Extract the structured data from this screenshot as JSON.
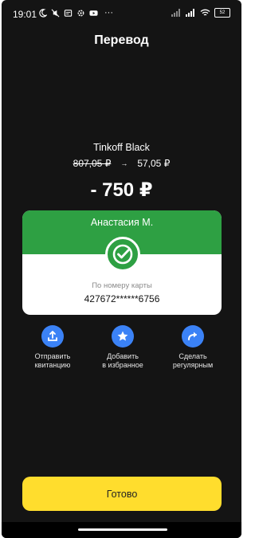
{
  "status_bar": {
    "time": "19:01",
    "more": "···",
    "battery": "52",
    "left_icons": [
      "moon-icon",
      "mute-icon",
      "notification-icon",
      "settings-icon",
      "youtube-icon"
    ],
    "right_icons": [
      "signal-icon",
      "signal-icon",
      "wifi-icon",
      "battery-icon"
    ]
  },
  "header": {
    "title": "Перевод"
  },
  "account": {
    "name": "Tinkoff Black",
    "balance_before": "807,05 ₽",
    "arrow": "→",
    "balance_after": "57,05 ₽"
  },
  "amount": "- 750 ₽",
  "recipient": {
    "name": "Анастасия М.",
    "method_label": "По номеру карты",
    "card_number": "427672******6756",
    "accent_color": "#2ea043"
  },
  "actions": [
    {
      "label": "Отправить\nквитанцию",
      "icon": "upload-icon"
    },
    {
      "label": "Добавить\nв избранное",
      "icon": "star-icon"
    },
    {
      "label": "Сделать\nрегулярным",
      "icon": "repeat-icon"
    }
  ],
  "done_button": {
    "label": "Готово",
    "color": "#ffdd2d"
  }
}
